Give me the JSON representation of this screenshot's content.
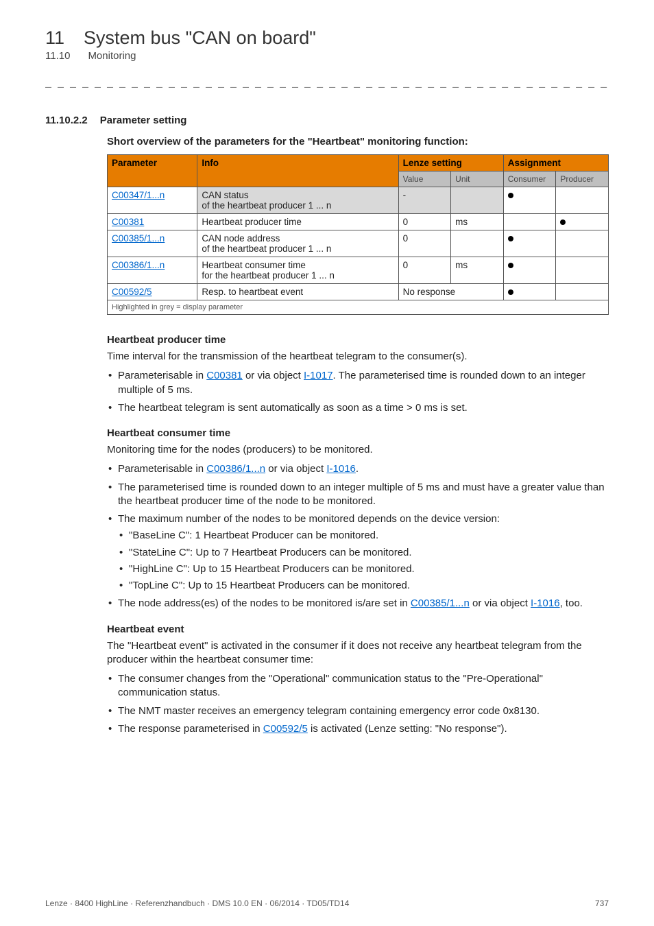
{
  "chapter": {
    "number": "11",
    "title": "System bus \"CAN on board\"",
    "sub_number": "11.10",
    "sub_title": "Monitoring"
  },
  "dashes": "_ _ _ _ _ _ _ _ _ _ _ _ _ _ _ _ _ _ _ _ _ _ _ _ _ _ _ _ _ _ _ _ _ _ _ _ _ _ _ _ _ _ _ _ _ _ _ _ _ _ _ _ _ _ _ _ _ _ _ _ _ _ _ _",
  "section": {
    "number": "11.10.2.2",
    "title": "Parameter setting"
  },
  "table": {
    "intro": "Short overview of the parameters for the \"Heartbeat\" monitoring function:",
    "headers": {
      "parameter": "Parameter",
      "info": "Info",
      "lenze_setting": "Lenze setting",
      "assignment": "Assignment",
      "value": "Value",
      "unit": "Unit",
      "consumer": "Consumer",
      "producer": "Producer"
    },
    "rows": [
      {
        "param": "C00347/1...n",
        "link": true,
        "info": "CAN status\nof the heartbeat producer 1 ... n",
        "value": "-",
        "unit": "",
        "value_cell_grey": true,
        "unit_cell_grey": true,
        "consumer_dot": true,
        "producer_dot": false,
        "grey_info": true
      },
      {
        "param": "C00381",
        "link": true,
        "info": "Heartbeat producer time",
        "value": "0",
        "unit": "ms",
        "consumer_dot": false,
        "producer_dot": true
      },
      {
        "param": "C00385/1...n",
        "link": true,
        "info": "CAN node address\nof the heartbeat producer 1 ... n",
        "value": "0",
        "unit": "",
        "consumer_dot": true,
        "producer_dot": false
      },
      {
        "param": "C00386/1...n",
        "link": true,
        "info": "Heartbeat consumer time\nfor the heartbeat producer 1 ... n",
        "value": "0",
        "unit": "ms",
        "consumer_dot": true,
        "producer_dot": false
      },
      {
        "param": "C00592/5",
        "link": true,
        "info": "Resp. to heartbeat event",
        "value_span": "No response",
        "consumer_dot": true,
        "producer_dot": false
      }
    ],
    "footnote": "Highlighted in grey = display parameter"
  },
  "hb_producer": {
    "title": "Heartbeat producer time",
    "para": "Time interval for the transmission of the heartbeat telegram to the consumer(s).",
    "bullet1_pre": "Parameterisable in ",
    "bullet1_link1": "C00381",
    "bullet1_mid": " or via object ",
    "bullet1_link2": "I-1017",
    "bullet1_post": ". The parameterised time is rounded down to an integer multiple of 5 ms.",
    "bullet2": "The heartbeat telegram is sent automatically as soon as a time > 0 ms is set."
  },
  "hb_consumer": {
    "title": "Heartbeat consumer time",
    "para": "Monitoring time for the nodes (producers) to be monitored.",
    "bullet1_pre": "Parameterisable in ",
    "bullet1_link1": "C00386/1...n",
    "bullet1_mid": " or via object ",
    "bullet1_link2": "I-1016",
    "bullet1_post": ".",
    "bullet2": "The parameterised time is rounded down to an integer multiple of 5 ms and must have a greater value than the heartbeat producer time of the node to be monitored.",
    "bullet3": "The maximum number of the nodes to be monitored depends on the device version:",
    "sub": [
      "\"BaseLine C\": 1 Heartbeat Producer can be monitored.",
      "\"StateLine C\": Up to 7 Heartbeat Producers can be monitored.",
      "\"HighLine C\": Up to 15 Heartbeat Producers can be monitored.",
      "\"TopLine C\": Up to 15 Heartbeat Producers can be monitored."
    ],
    "bullet4_pre": "The node address(es) of the nodes to be monitored is/are set in ",
    "bullet4_link1": "C00385/1...n",
    "bullet4_mid": " or via object ",
    "bullet4_link2": "I-1016",
    "bullet4_post": ", too."
  },
  "hb_event": {
    "title": "Heartbeat event",
    "para": "The \"Heartbeat event\" is activated in the consumer if it does not receive any heartbeat telegram from the producer within the heartbeat consumer time:",
    "bullet1": "The consumer changes from the \"Operational\" communication status to the \"Pre-Operational\" communication status.",
    "bullet2": "The NMT master receives an emergency telegram containing emergency error code 0x8130.",
    "bullet3_pre": "The response parameterised in ",
    "bullet3_link": "C00592/5",
    "bullet3_post": " is activated (Lenze setting: \"No response\")."
  },
  "footer": {
    "left": "Lenze · 8400 HighLine · Referenzhandbuch · DMS 10.0 EN · 06/2014 · TD05/TD14",
    "right": "737"
  }
}
